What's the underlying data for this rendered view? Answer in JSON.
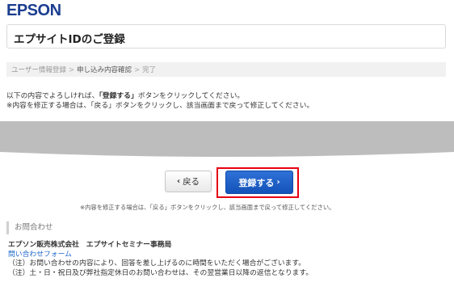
{
  "brand": {
    "logo_text": "EPSON",
    "color": "#1b3e8f"
  },
  "page": {
    "title": "エプサイトIDのご登録"
  },
  "breadcrumb": {
    "steps": [
      "ユーザー情報登録",
      "申し込み内容確認",
      "完了"
    ],
    "separator": ">",
    "current_index": 1
  },
  "notice": {
    "line1_before": "以下の内容でよろしければ、",
    "line1_emph": "「登録する」",
    "line1_after": "ボタンをクリックしてください。",
    "line2": "※内容を修正する場合は、「戻る」ボタンをクリックし、該当画面まで戻って修正してください。"
  },
  "buttons": {
    "back_label": "戻る",
    "back_icon": "chevron-left-icon",
    "submit_label": "登録する",
    "submit_icon": "chevron-right-icon",
    "submit_color": "#1a5cc7",
    "highlight_color": "#e60012"
  },
  "footnote": "※内容を修正する場合は、「戻る」ボタンをクリックし、該当画面まで戻って修正してください。",
  "contact": {
    "heading": "お問合わせ",
    "org": "エプソン販売株式会社　エプサイトセミナー事務局",
    "form_link": "問い合わせフォーム",
    "note1": "（注）お問い合わせの内容により、回答を差し上げるのに時間をいただく場合がございます。",
    "note2": "（注）土・日・祝日及び弊社指定休日のお問い合わせは、その翌営業日以降の返信となります。"
  }
}
